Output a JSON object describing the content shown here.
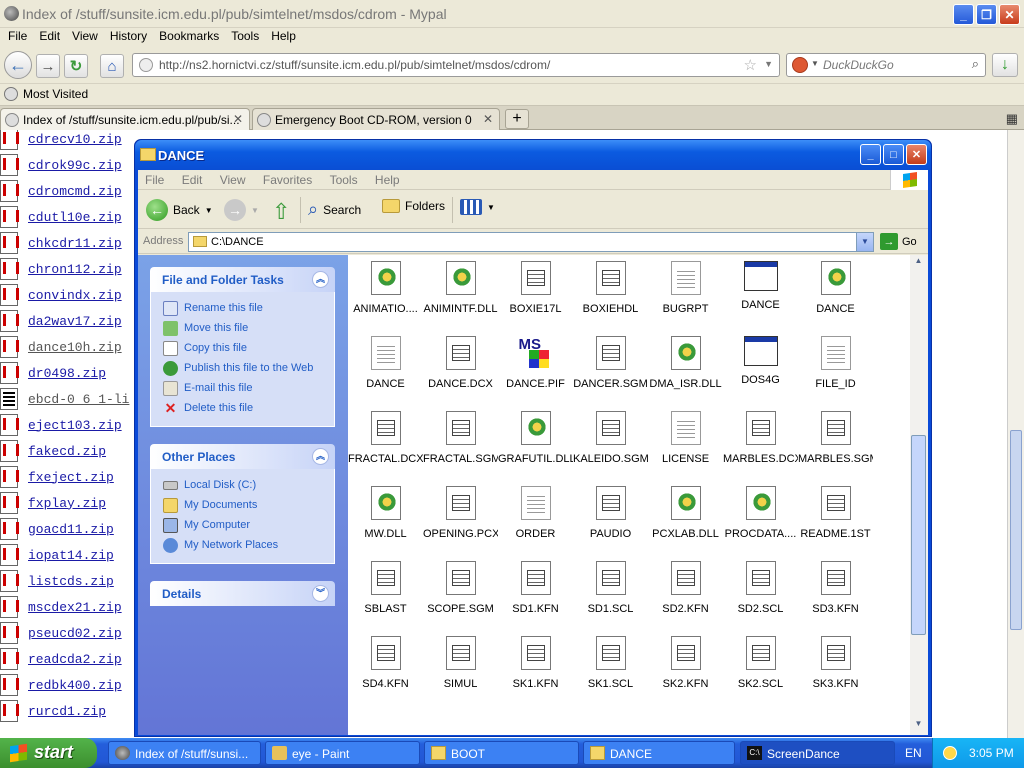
{
  "browser": {
    "title": "Index of /stuff/sunsite.icm.edu.pl/pub/simtelnet/msdos/cdrom - Mypal",
    "menu": [
      "File",
      "Edit",
      "View",
      "History",
      "Bookmarks",
      "Tools",
      "Help"
    ],
    "url": "http://ns2.hornictvi.cz/stuff/sunsite.icm.edu.pl/pub/simtelnet/msdos/cdrom/",
    "search_placeholder": "DuckDuckGo",
    "bookmark": "Most Visited",
    "tabs": [
      {
        "label": "Index of /stuff/sunsite.icm.edu.pl/pub/si..."
      },
      {
        "label": "Emergency Boot CD-ROM, version 0"
      }
    ],
    "new_tab": "+"
  },
  "listing": [
    {
      "name": "cdrecv10.zip",
      "visited": false
    },
    {
      "name": "cdrok99c.zip",
      "visited": false
    },
    {
      "name": "cdromcmd.zip",
      "visited": false
    },
    {
      "name": "cdutl10e.zip",
      "visited": false
    },
    {
      "name": "chkcdr11.zip",
      "visited": false
    },
    {
      "name": "chron112.zip",
      "visited": false
    },
    {
      "name": "convindx.zip",
      "visited": false
    },
    {
      "name": "da2wav17.zip",
      "visited": false
    },
    {
      "name": "dance10h.zip",
      "visited": true
    },
    {
      "name": "dr0498.zip",
      "visited": false
    },
    {
      "name": "ebcd-0 6 1-li",
      "visited": true
    },
    {
      "name": "eject103.zip",
      "visited": false
    },
    {
      "name": "fakecd.zip",
      "visited": false
    },
    {
      "name": "fxeject.zip",
      "visited": false
    },
    {
      "name": "fxplay.zip",
      "visited": false
    },
    {
      "name": "goacd11.zip",
      "visited": false
    },
    {
      "name": "iopat14.zip",
      "visited": false
    },
    {
      "name": "listcds.zip",
      "visited": false
    },
    {
      "name": "mscdex21.zip",
      "visited": false
    },
    {
      "name": "pseucd02.zip",
      "visited": false
    },
    {
      "name": "readcda2.zip",
      "visited": false
    },
    {
      "name": "redbk400.zip",
      "visited": false
    },
    {
      "name": "rurcd1.zip",
      "visited": false
    }
  ],
  "explorer": {
    "title": "DANCE",
    "menu": [
      "File",
      "Edit",
      "View",
      "Favorites",
      "Tools",
      "Help"
    ],
    "toolbar": {
      "back": "Back",
      "search": "Search",
      "folders": "Folders"
    },
    "address_label": "Address",
    "address": "C:\\DANCE",
    "go": "Go",
    "file_tasks": {
      "title": "File and Folder Tasks",
      "items": [
        "Rename this file",
        "Move this file",
        "Copy this file",
        "Publish this file to the Web",
        "E-mail this file",
        "Delete this file"
      ]
    },
    "other_places": {
      "title": "Other Places",
      "items": [
        "Local Disk (C:)",
        "My Documents",
        "My Computer",
        "My Network Places"
      ]
    },
    "details": {
      "title": "Details"
    },
    "files": [
      {
        "name": "ANIMATIO....",
        "icon": "dll"
      },
      {
        "name": "ANIMINTF.DLL",
        "icon": "dll"
      },
      {
        "name": "BOXIE17L",
        "icon": "doc"
      },
      {
        "name": "BOXIEHDL",
        "icon": "doc"
      },
      {
        "name": "BUGRPT",
        "icon": "txt"
      },
      {
        "name": "DANCE",
        "icon": "exe"
      },
      {
        "name": "DANCE",
        "icon": "dll"
      },
      {
        "name": "DANCE",
        "icon": "txt"
      },
      {
        "name": "DANCE.DCX",
        "icon": "doc"
      },
      {
        "name": "DANCE.PIF",
        "icon": "pif"
      },
      {
        "name": "DANCER.SGM",
        "icon": "doc"
      },
      {
        "name": "DMA_ISR.DLL",
        "icon": "dll"
      },
      {
        "name": "DOS4G",
        "icon": "exe"
      },
      {
        "name": "FILE_ID",
        "icon": "txt"
      },
      {
        "name": "FRACTAL.DCX",
        "icon": "doc"
      },
      {
        "name": "FRACTAL.SGM",
        "icon": "doc"
      },
      {
        "name": "GRAFUTIL.DLL",
        "icon": "dll"
      },
      {
        "name": "KALEIDO.SGM",
        "icon": "doc"
      },
      {
        "name": "LICENSE",
        "icon": "txt"
      },
      {
        "name": "MARBLES.DCX",
        "icon": "doc"
      },
      {
        "name": "MARBLES.SGM",
        "icon": "doc"
      },
      {
        "name": "MW.DLL",
        "icon": "dll"
      },
      {
        "name": "OPENING.PCX",
        "icon": "doc"
      },
      {
        "name": "ORDER",
        "icon": "txt"
      },
      {
        "name": "PAUDIO",
        "icon": "doc"
      },
      {
        "name": "PCXLAB.DLL",
        "icon": "dll"
      },
      {
        "name": "PROCDATA....",
        "icon": "dll"
      },
      {
        "name": "README.1ST",
        "icon": "doc"
      },
      {
        "name": "SBLAST",
        "icon": "doc"
      },
      {
        "name": "SCOPE.SGM",
        "icon": "doc"
      },
      {
        "name": "SD1.KFN",
        "icon": "doc"
      },
      {
        "name": "SD1.SCL",
        "icon": "doc"
      },
      {
        "name": "SD2.KFN",
        "icon": "doc"
      },
      {
        "name": "SD2.SCL",
        "icon": "doc"
      },
      {
        "name": "SD3.KFN",
        "icon": "doc"
      },
      {
        "name": "SD4.KFN",
        "icon": "doc"
      },
      {
        "name": "SIMUL",
        "icon": "doc"
      },
      {
        "name": "SK1.KFN",
        "icon": "doc"
      },
      {
        "name": "SK1.SCL",
        "icon": "doc"
      },
      {
        "name": "SK2.KFN",
        "icon": "doc"
      },
      {
        "name": "SK2.SCL",
        "icon": "doc"
      },
      {
        "name": "SK3.KFN",
        "icon": "doc"
      }
    ]
  },
  "taskbar": {
    "start": "start",
    "tasks": [
      {
        "label": "Index of /stuff/sunsi..."
      },
      {
        "label": "eye - Paint"
      },
      {
        "label": "BOOT"
      },
      {
        "label": "DANCE"
      },
      {
        "label": "ScreenDance"
      }
    ],
    "lang": "EN",
    "time": "3:05 PM"
  }
}
